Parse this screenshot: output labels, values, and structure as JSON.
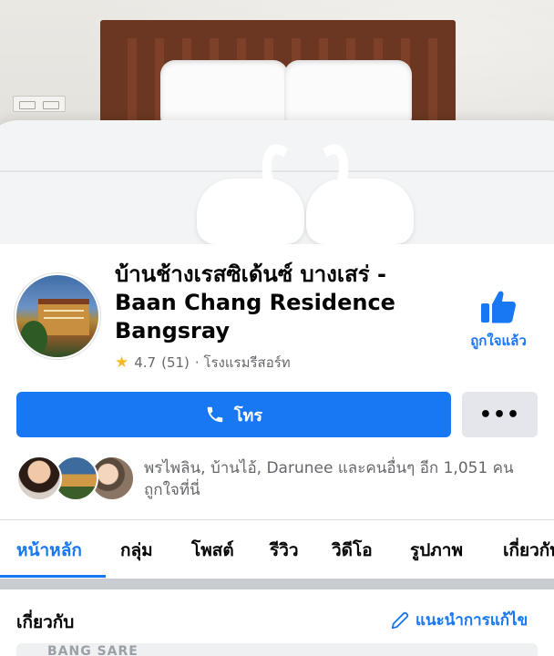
{
  "page": {
    "name_thai": "บ้านช้างเรสซิเด้นซ์ บางเสร่ -",
    "name_english_1": "Baan Chang Residence",
    "name_english_2": "Bangsray",
    "like_label": "ถูกใจแล้ว",
    "rating": "4.7",
    "review_count": "(51)",
    "category": "· โรงแรมรีสอร์ท"
  },
  "actions": {
    "call_label": "โทร",
    "more_label": "•••"
  },
  "friends": {
    "text": "พรไพลิน, บ้านไอ้, Darunee และคนอื่นๆ อีก 1,051 คนถูกใจที่นี่"
  },
  "tabs": [
    {
      "label": "หน้าหลัก"
    },
    {
      "label": "กลุ่ม"
    },
    {
      "label": "โพสต์"
    },
    {
      "label": "รีวิว"
    },
    {
      "label": "วิดีโอ"
    },
    {
      "label": "รูปภาพ"
    },
    {
      "label": "เกี่ยวกับ"
    }
  ],
  "about": {
    "heading": "เกี่ยวกับ",
    "edit_label": "แนะนำการแก้ไข",
    "peek_text": "BANG SARE"
  },
  "colors": {
    "accent": "#1877f2",
    "secondary_button": "#e4e6eb",
    "muted_text": "#65676b",
    "star": "#f7b928"
  },
  "icons": {
    "like": "thumbs-up-icon",
    "call": "phone-icon",
    "star": "star-icon",
    "edit": "pencil-icon"
  }
}
